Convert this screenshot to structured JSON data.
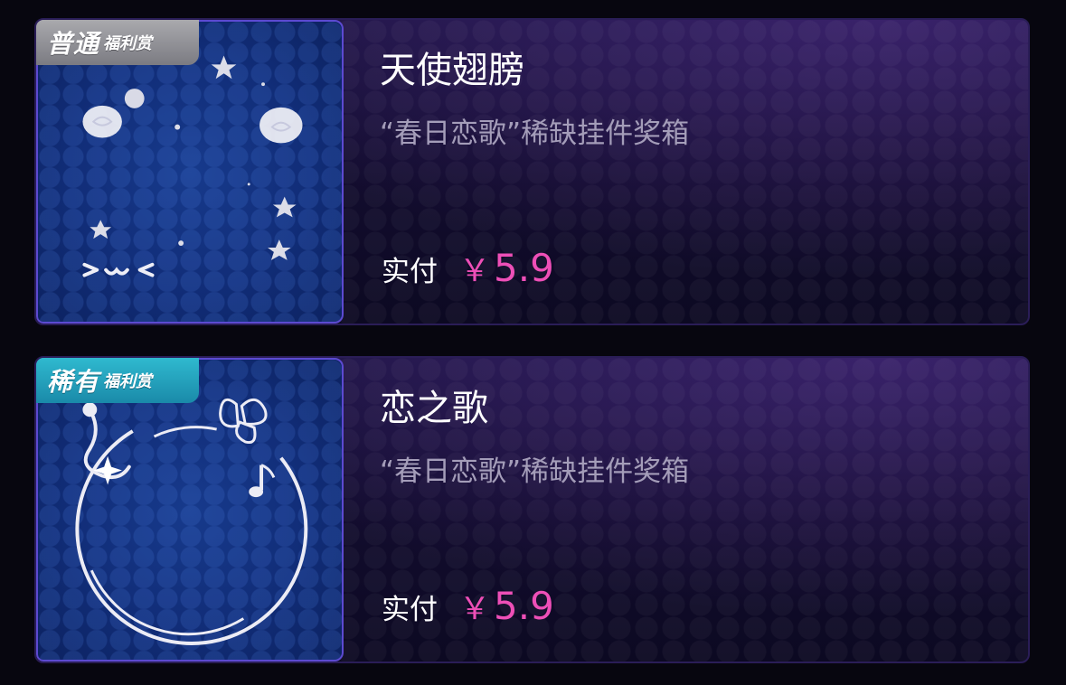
{
  "items": [
    {
      "tag_main": "普通",
      "tag_sub": "福利赏",
      "tag_type": "normal",
      "title": "天使翅膀",
      "subtitle": "“春日恋歌”稀缺挂件奖箱",
      "pay_label": "实付",
      "currency": "￥",
      "price": "5.9",
      "image_icon": "angel-wings-face-icon"
    },
    {
      "tag_main": "稀有",
      "tag_sub": "福利赏",
      "tag_type": "rare",
      "title": "恋之歌",
      "subtitle": "“春日恋歌”稀缺挂件奖箱",
      "pay_label": "实付",
      "currency": "￥",
      "price": "5.9",
      "image_icon": "love-song-ring-icon"
    }
  ],
  "colors": {
    "price": "#ee4fb7",
    "subtitle": "#a49db9",
    "tag_normal": "#8f8f95",
    "tag_rare": "#23a3bd",
    "thumb_border": "#5c4ad1"
  }
}
